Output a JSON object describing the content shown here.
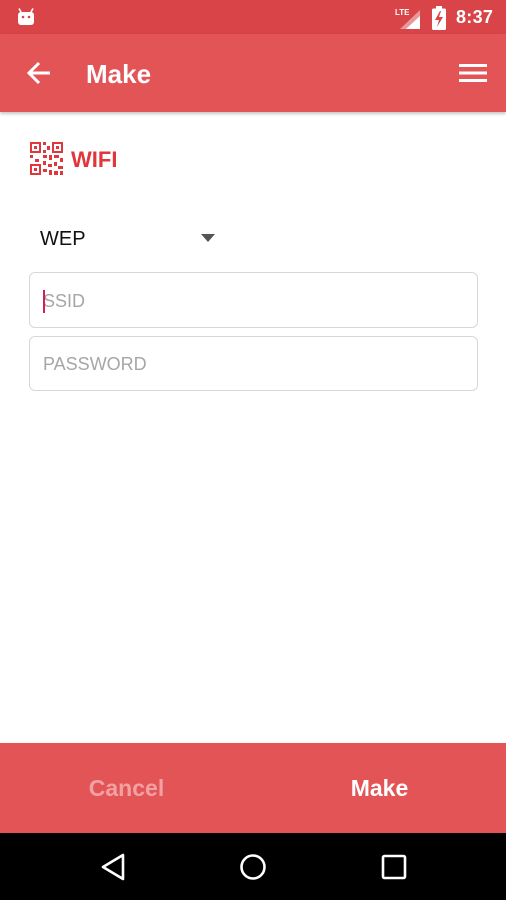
{
  "status_bar": {
    "time": "8:37",
    "network": "LTE",
    "icons": [
      "android-icon",
      "lte-signal-icon",
      "battery-charging-icon"
    ]
  },
  "app_bar": {
    "title": "Make",
    "icons": [
      "back-arrow-icon",
      "menu-icon"
    ]
  },
  "section": {
    "title": "WIFI",
    "icon": "qr-code-icon",
    "accent_color": "#e0363c"
  },
  "form": {
    "security_type": "WEP",
    "ssid": {
      "value": "",
      "placeholder": "SSID"
    },
    "password": {
      "value": "",
      "placeholder": "PASSWORD"
    }
  },
  "bottom_actions": {
    "cancel_label": "Cancel",
    "make_label": "Make"
  },
  "nav_bar": {
    "icons": [
      "nav-back-icon",
      "nav-home-icon",
      "nav-recents-icon"
    ]
  },
  "colors": {
    "status_bar": "#d84448",
    "primary": "#e35457",
    "cancel_text": "#f2a1a3",
    "nav_bar": "#000000"
  }
}
